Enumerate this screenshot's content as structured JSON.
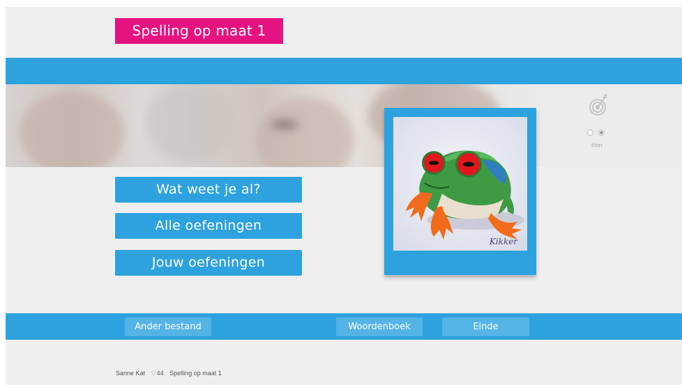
{
  "app": {
    "title": "Spelling op maat 1"
  },
  "menu": {
    "items": [
      {
        "label": "Wat weet je al?"
      },
      {
        "label": "Alle oefeningen"
      },
      {
        "label": "Jouw oefeningen"
      }
    ]
  },
  "card": {
    "caption": "Kikker",
    "image": "tree-frog"
  },
  "tools": {
    "icon": "target-icon",
    "filter_label": "filter"
  },
  "nav": {
    "other_file": "Ander bestand",
    "dictionary": "Woordenboek",
    "end": "Einde"
  },
  "footer": {
    "user": "Sanne Kat",
    "heart_icon": "♡",
    "score": "44",
    "course": "Spelling op maat 1"
  },
  "colors": {
    "accent": "#2ea2de",
    "title_bg": "#e5137f",
    "background": "#efefef"
  }
}
